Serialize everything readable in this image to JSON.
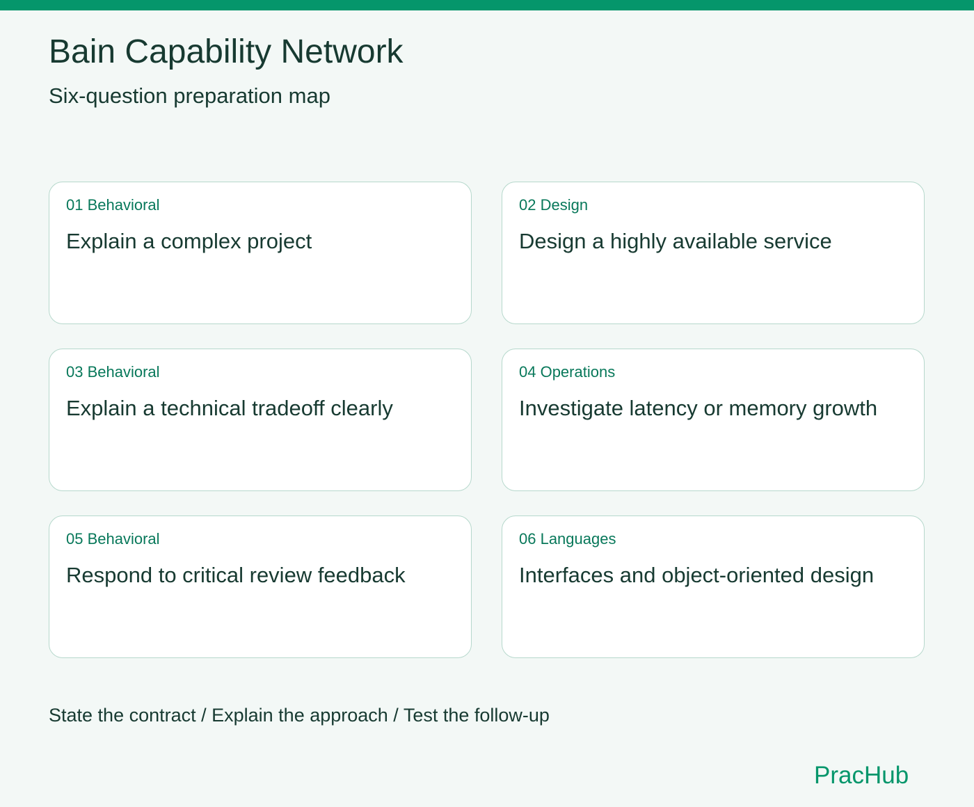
{
  "colors": {
    "accent": "#05966b",
    "tag_text": "#08785a",
    "text": "#173a31",
    "background": "#f3f8f6",
    "card_border": "#b6d8cc",
    "card_background": "#ffffff"
  },
  "header": {
    "title": "Bain Capability Network",
    "subtitle": "Six-question preparation map"
  },
  "cards": [
    {
      "tag": "01 Behavioral",
      "question": "Explain a complex project"
    },
    {
      "tag": "02 Design",
      "question": "Design a highly available service"
    },
    {
      "tag": "03 Behavioral",
      "question": "Explain a technical tradeoff clearly"
    },
    {
      "tag": "04 Operations",
      "question": "Investigate latency or memory growth"
    },
    {
      "tag": "05 Behavioral",
      "question": "Respond to critical review feedback"
    },
    {
      "tag": "06 Languages",
      "question": "Interfaces and object-oriented design"
    }
  ],
  "footer": {
    "steps": "State the contract / Explain the approach / Test the follow-up",
    "brand": "PracHub"
  }
}
